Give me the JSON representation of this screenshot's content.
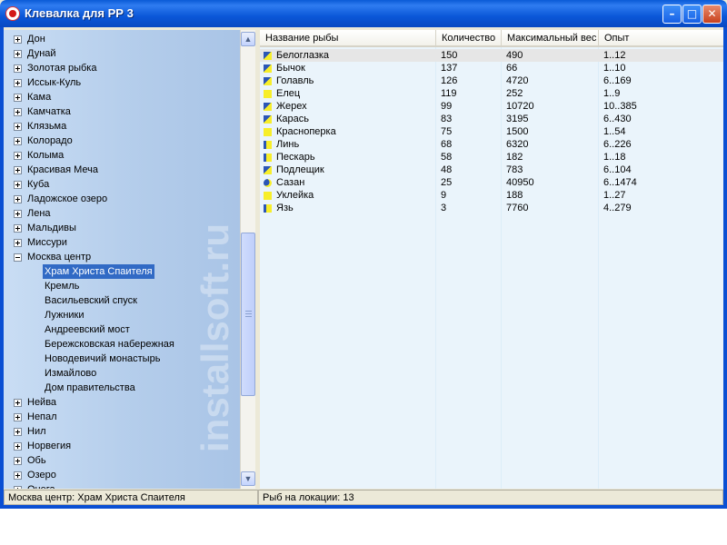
{
  "window": {
    "title": "Клевалка для РР 3",
    "minimize_glyph": "–",
    "maximize_glyph": "□",
    "close_glyph": "✕"
  },
  "tree": {
    "items": [
      {
        "label": "Дон",
        "state": "collapsed"
      },
      {
        "label": "Дунай",
        "state": "collapsed"
      },
      {
        "label": "Золотая рыбка",
        "state": "collapsed"
      },
      {
        "label": "Иссык-Куль",
        "state": "collapsed"
      },
      {
        "label": "Кама",
        "state": "collapsed"
      },
      {
        "label": "Камчатка",
        "state": "collapsed"
      },
      {
        "label": "Клязьма",
        "state": "collapsed"
      },
      {
        "label": "Колорадо",
        "state": "collapsed"
      },
      {
        "label": "Колыма",
        "state": "collapsed"
      },
      {
        "label": "Красивая Меча",
        "state": "collapsed"
      },
      {
        "label": "Куба",
        "state": "collapsed"
      },
      {
        "label": "Ладожское озеро",
        "state": "collapsed"
      },
      {
        "label": "Лена",
        "state": "collapsed"
      },
      {
        "label": "Мальдивы",
        "state": "collapsed"
      },
      {
        "label": "Миссури",
        "state": "collapsed"
      },
      {
        "label": "Москва центр",
        "state": "expanded"
      },
      {
        "label": "Храм Христа Спаителя",
        "state": "child",
        "selected": true
      },
      {
        "label": "Кремль",
        "state": "child"
      },
      {
        "label": "Васильевский спуск",
        "state": "child"
      },
      {
        "label": "Лужники",
        "state": "child"
      },
      {
        "label": "Андреевский мост",
        "state": "child"
      },
      {
        "label": "Бережсковская набережная",
        "state": "child"
      },
      {
        "label": "Новодевичий монастырь",
        "state": "child"
      },
      {
        "label": "Измайлово",
        "state": "child"
      },
      {
        "label": "Дом правительства",
        "state": "child"
      },
      {
        "label": "Нейва",
        "state": "collapsed"
      },
      {
        "label": "Непал",
        "state": "collapsed"
      },
      {
        "label": "Нил",
        "state": "collapsed"
      },
      {
        "label": "Норвегия",
        "state": "collapsed"
      },
      {
        "label": "Обь",
        "state": "collapsed"
      },
      {
        "label": "Озеро",
        "state": "collapsed"
      },
      {
        "label": "Онега",
        "state": "collapsed"
      }
    ],
    "watermark_text": "installsoft.ru"
  },
  "scrollbar": {
    "up_glyph": "▲",
    "down_glyph": "▼"
  },
  "list": {
    "columns": [
      "Название рыбы",
      "Количество",
      "Максимальный вес",
      "Опыт"
    ],
    "rows": [
      {
        "icon": "a",
        "name": "Белоглазка",
        "count": "150",
        "max_weight": "490",
        "exp": "1..12"
      },
      {
        "icon": "a",
        "name": "Бычок",
        "count": "137",
        "max_weight": "66",
        "exp": "1..10"
      },
      {
        "icon": "a",
        "name": "Голавль",
        "count": "126",
        "max_weight": "4720",
        "exp": "6..169"
      },
      {
        "icon": "y",
        "name": "Елец",
        "count": "119",
        "max_weight": "252",
        "exp": "1..9"
      },
      {
        "icon": "a",
        "name": "Жерех",
        "count": "99",
        "max_weight": "10720",
        "exp": "10..385"
      },
      {
        "icon": "a",
        "name": "Карась",
        "count": "83",
        "max_weight": "3195",
        "exp": "6..430"
      },
      {
        "icon": "y",
        "name": "Красноперка",
        "count": "75",
        "max_weight": "1500",
        "exp": "1..54"
      },
      {
        "icon": "b",
        "name": "Линь",
        "count": "68",
        "max_weight": "6320",
        "exp": "6..226"
      },
      {
        "icon": "b",
        "name": "Пескарь",
        "count": "58",
        "max_weight": "182",
        "exp": "1..18"
      },
      {
        "icon": "a",
        "name": "Подлещик",
        "count": "48",
        "max_weight": "783",
        "exp": "6..104"
      },
      {
        "icon": "c",
        "name": "Сазан",
        "count": "25",
        "max_weight": "40950",
        "exp": "6..1474"
      },
      {
        "icon": "y",
        "name": "Уклейка",
        "count": "9",
        "max_weight": "188",
        "exp": "1..27"
      },
      {
        "icon": "b",
        "name": "Язь",
        "count": "3",
        "max_weight": "7760",
        "exp": "4..279"
      }
    ]
  },
  "status": {
    "location": "Москва центр: Храм Христа Спаителя",
    "fish_count": "Рыб на локации: 13"
  }
}
